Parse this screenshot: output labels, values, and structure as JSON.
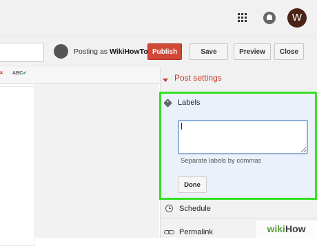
{
  "topbar": {
    "apps_icon": "apps-grid-icon",
    "notifications_icon": "bell-icon",
    "avatar_letter": "W"
  },
  "toolbar": {
    "posting_prefix": "Posting as ",
    "posting_user": "WikiHowTo",
    "publish_label": "Publish",
    "save_label": "Save",
    "preview_label": "Preview",
    "close_label": "Close",
    "publish_color": "#d14836"
  },
  "editor": {
    "spellcheck_label": "ABC"
  },
  "post_settings": {
    "title": "Post settings",
    "accent_color": "#c0392b",
    "labels": {
      "title": "Labels",
      "input_value": "",
      "hint": "Separate labels by commas",
      "done_label": "Done",
      "highlight_color": "#33e023"
    },
    "schedule_label": "Schedule",
    "permalink_label": "Permalink"
  },
  "watermark": {
    "part1": "wiki",
    "part2": "How"
  }
}
